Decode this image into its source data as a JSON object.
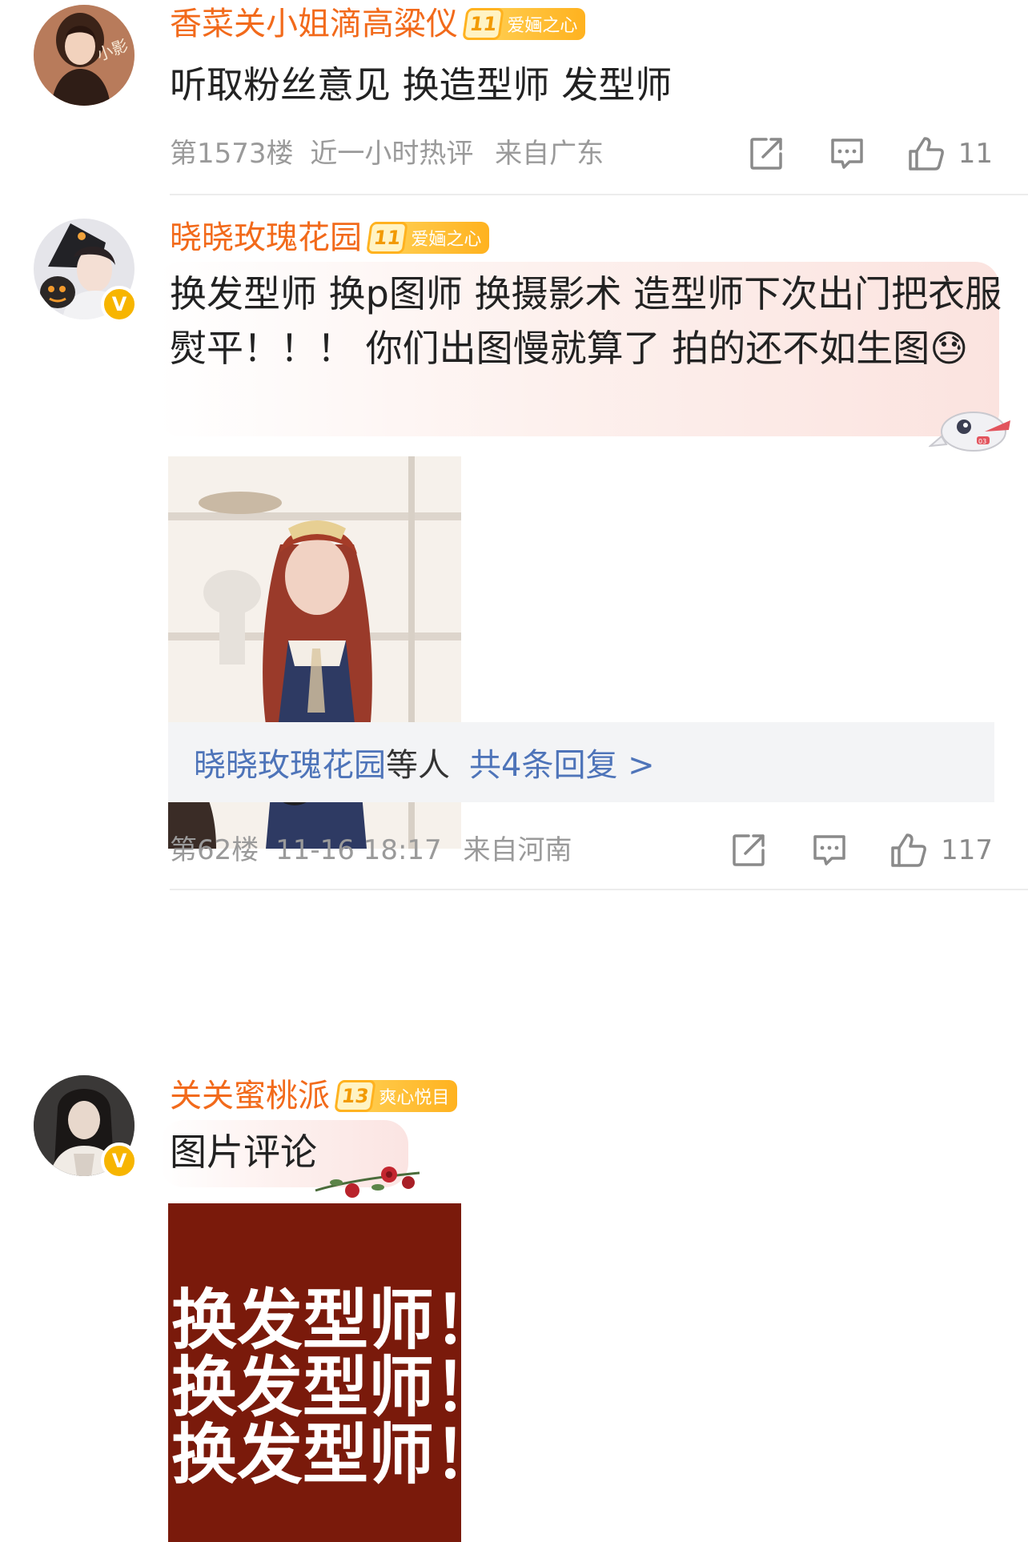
{
  "comments": [
    {
      "username": "香菜关小姐滴高粱仪",
      "fan_level": "11",
      "fan_badge": "爱婳之心",
      "text": "听取粉丝意见 换造型师 发型师",
      "floor": "第1573楼",
      "hot_tag": "近一小时热评",
      "location": "来自广东",
      "likes": "11",
      "avatar_icon": "user-avatar-portrait",
      "verified": false
    },
    {
      "username": "晓晓玫瑰花园",
      "fan_level": "11",
      "fan_badge": "爱婳之心",
      "text": "换发型师 换p图师 换摄影术 造型师下次出门把衣服熨平！！！ 你们出图慢就算了 拍的还不如生图",
      "emoji": "😓",
      "floor": "第62楼",
      "time": "11-16 18:17",
      "location": "来自河南",
      "likes": "117",
      "replies": {
        "user": "晓晓玫瑰花园",
        "etc": "等人",
        "count_text": "共4条回复 >"
      },
      "avatar_icon": "user-avatar-portrait",
      "verified": true,
      "verified_mark": "V"
    },
    {
      "username": "关关蜜桃派",
      "fan_level": "13",
      "fan_badge": "爽心悦目",
      "text": "图片评论",
      "poster_lines": [
        "换发型师！",
        "换发型师！",
        "换发型师！"
      ],
      "avatar_icon": "user-avatar-portrait",
      "verified": true,
      "verified_mark": "V"
    }
  ],
  "icons": {
    "share": "share-icon",
    "comment": "comment-icon",
    "like": "like-icon",
    "verified": "verified-icon"
  },
  "colors": {
    "username": "#f26a1b",
    "meta": "#9a9a9a",
    "reply_link": "#4e74b9",
    "badge_gold": "#ffb21f",
    "poster_bg": "#7a1a0b"
  }
}
